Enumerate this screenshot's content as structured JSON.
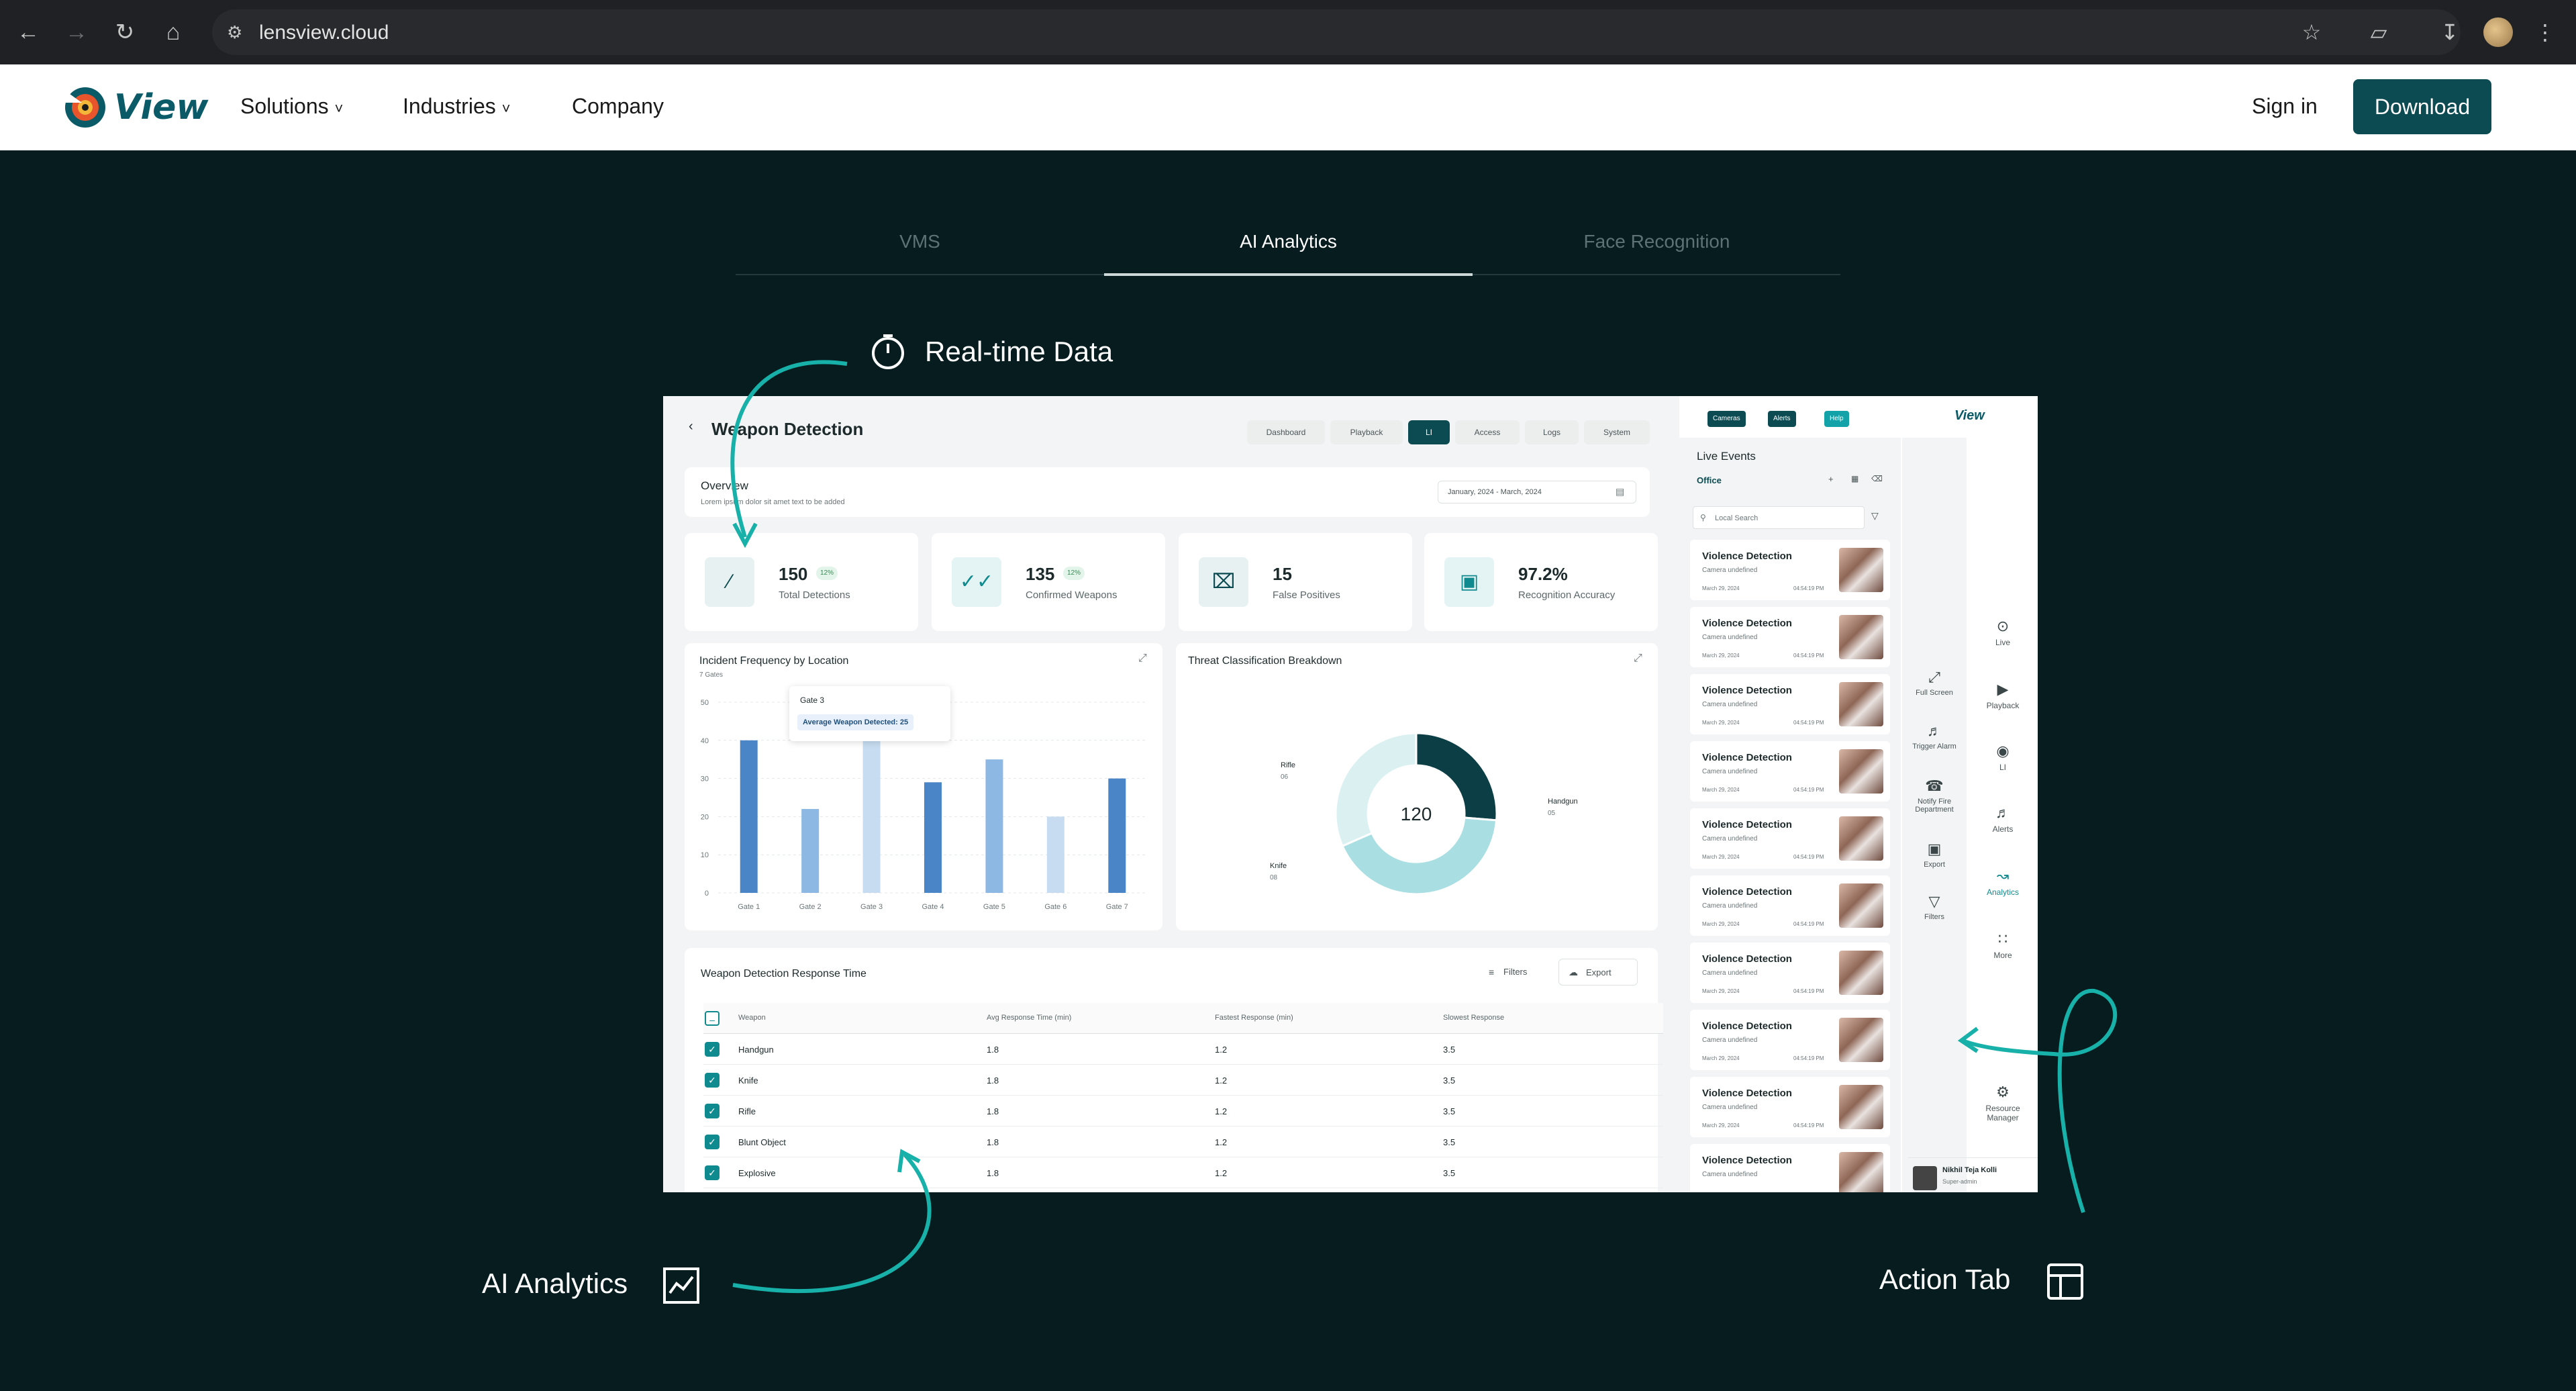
{
  "browser": {
    "url": "lensview.cloud",
    "icons": [
      "back-icon",
      "forward-icon",
      "reload-icon",
      "home-icon",
      "site-info-icon",
      "star-icon",
      "extensions-icon",
      "download-icon",
      "profile-avatar",
      "menu-icon"
    ]
  },
  "site": {
    "logo_text": "View",
    "nav": {
      "solutions": "Solutions",
      "industries": "Industries",
      "company": "Company"
    },
    "sign_in": "Sign in",
    "download": "Download"
  },
  "product_tabs": {
    "items": [
      "VMS",
      "AI Analytics",
      "Face Recognition"
    ],
    "active": "AI Analytics"
  },
  "callouts": {
    "realtime": "Real-time Data",
    "ai_analytics": "AI Analytics",
    "action_tab": "Action Tab"
  },
  "dashboard": {
    "title": "Weapon Detection",
    "nav_pills": [
      "Dashboard",
      "Playback",
      "LI",
      "Access",
      "Logs",
      "System"
    ],
    "active_pill": "LI",
    "overview": {
      "title": "Overview",
      "subtitle": "Lorem ipsum dolor sit amet text to be added",
      "date_range": "January, 2024 - March, 2024"
    },
    "kpis": [
      {
        "value": "150",
        "label": "Total Detections",
        "badge": "12%",
        "icon": "knife-icon"
      },
      {
        "value": "135",
        "label": "Confirmed Weapons",
        "badge": "12%",
        "icon": "double-check-icon"
      },
      {
        "value": "15",
        "label": "False Positives",
        "badge": "",
        "icon": "x-box-icon"
      },
      {
        "value": "97.2%",
        "label": "Recognition Accuracy",
        "badge": "",
        "icon": "target-icon"
      }
    ],
    "bar_chart": {
      "title": "Incident Frequency by Location",
      "subtitle": "7 Gates",
      "tooltip_title": "Gate 3",
      "tooltip_value": "Average Weapon Detected: 25"
    },
    "donut_chart": {
      "title": "Threat Classification Breakdown",
      "center_value": "120",
      "labels": [
        {
          "name": "Rifle",
          "value": "06"
        },
        {
          "name": "Handgun",
          "value": "05"
        },
        {
          "name": "Knife",
          "value": "08"
        }
      ]
    },
    "table": {
      "title": "Weapon Detection Response Time",
      "filters_label": "Filters",
      "export_label": "Export",
      "headers": [
        "Weapon",
        "Avg Response Time (min)",
        "Fastest Response (min)",
        "Slowest Response"
      ],
      "rows": [
        [
          "Handgun",
          "1.8",
          "1.2",
          "3.5"
        ],
        [
          "Knife",
          "1.8",
          "1.2",
          "3.5"
        ],
        [
          "Rifle",
          "1.8",
          "1.2",
          "3.5"
        ],
        [
          "Blunt Object",
          "1.8",
          "1.2",
          "3.5"
        ],
        [
          "Explosive",
          "1.8",
          "1.2",
          "3.5"
        ]
      ]
    },
    "right_panel": {
      "top_buttons": [
        "Cameras",
        "Alerts",
        "Help"
      ],
      "logo_text": "View",
      "live_events_title": "Live Events",
      "location": "Office",
      "search_placeholder": "Local Search",
      "event_title": "Violence Detection",
      "event_sub": "Camera undefined",
      "event_date": "March 29, 2024",
      "event_time": "04:54:19 PM",
      "actions": [
        "Full Screen",
        "Trigger Alarm",
        "Notify Fire Department",
        "Export",
        "Filters"
      ],
      "sidebar": [
        "Live",
        "Playback",
        "LI",
        "Alerts",
        "Analytics",
        "More"
      ],
      "sidebar_active": "Analytics",
      "resource_manager": "Resource Manager",
      "user_name": "Nikhil Teja Kolli",
      "user_role": "Super-admin"
    }
  },
  "chart_data": [
    {
      "type": "bar",
      "title": "Incident Frequency by Location",
      "categories": [
        "Gate 1",
        "Gate 2",
        "Gate 3",
        "Gate 4",
        "Gate 5",
        "Gate 6",
        "Gate 7"
      ],
      "values": [
        40,
        22,
        40,
        29,
        35,
        20,
        30
      ],
      "ylim": [
        0,
        50
      ],
      "yticks": [
        0,
        10,
        20,
        30,
        40,
        50
      ],
      "colors": [
        "#4a86c7",
        "#8db8e3",
        "#c7dcf1",
        "#4a86c7",
        "#8db8e3",
        "#c7dcf1",
        "#4a86c7"
      ]
    },
    {
      "type": "pie",
      "title": "Threat Classification Breakdown",
      "categories": [
        "Handgun",
        "Knife",
        "Rifle"
      ],
      "values": [
        5,
        8,
        6
      ],
      "colors": [
        "#0b3f45",
        "#a9dfe2",
        "#dbf0f1"
      ]
    }
  ]
}
